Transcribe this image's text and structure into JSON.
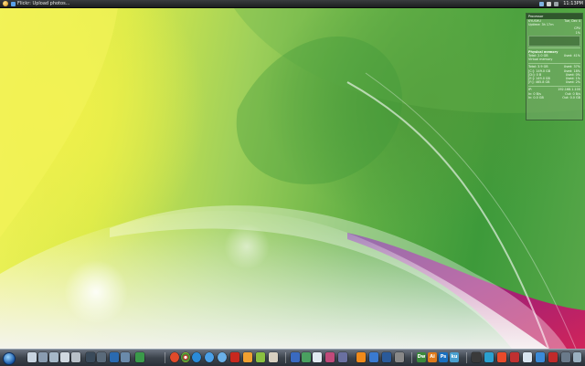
{
  "top_bar": {
    "window_title": "Flickr: Upload photos...",
    "clock": "11:13PM"
  },
  "system_monitor": {
    "title": "Processor",
    "rows": [
      {
        "left": "KYUSHU",
        "right": "Tue, Dec 4"
      },
      {
        "left": "Uptime: 3h 17m",
        "right": ""
      },
      {
        "left": "",
        "right": "CPU"
      },
      {
        "left": "",
        "right": "1%"
      }
    ],
    "memory_title": "Physical memory",
    "memory_rows": [
      {
        "left": "Total: 2.0 GB",
        "right": "Used: 41%"
      },
      {
        "left": "Virtual memory",
        "right": ""
      }
    ],
    "drives": [
      {
        "left": "Total: 3.9 GB",
        "right": "Used: 37%"
      },
      {
        "left": "[C:]: 149.0 GB",
        "right": "Used: 18%"
      },
      {
        "left": "[D:]: 0 B",
        "right": "Used: 0%"
      },
      {
        "left": "[E:]: 149.0 GB",
        "right": "Used: 1%"
      },
      {
        "left": "[F:]: 465.8 GB",
        "right": "Used: 2%"
      }
    ],
    "network": [
      {
        "left": "IP:",
        "right": "192.168.1.100"
      },
      {
        "left": "In: 0 B/s",
        "right": "Out: 0 B/s"
      },
      {
        "left": "In: 0.0 GB",
        "right": "Out: 0.0 GB"
      }
    ]
  },
  "dock": {
    "labels": [
      "Dw",
      "Ai",
      "Ps",
      "ku"
    ]
  },
  "colors": {
    "wallpaper_yellow": "#f2f35a",
    "wallpaper_green": "#3d9a3a",
    "wallpaper_purple": "#7a2a8a",
    "wallpaper_magenta": "#c0205a",
    "dock": "#3c434c",
    "top_bar": "#1c1e1f"
  }
}
